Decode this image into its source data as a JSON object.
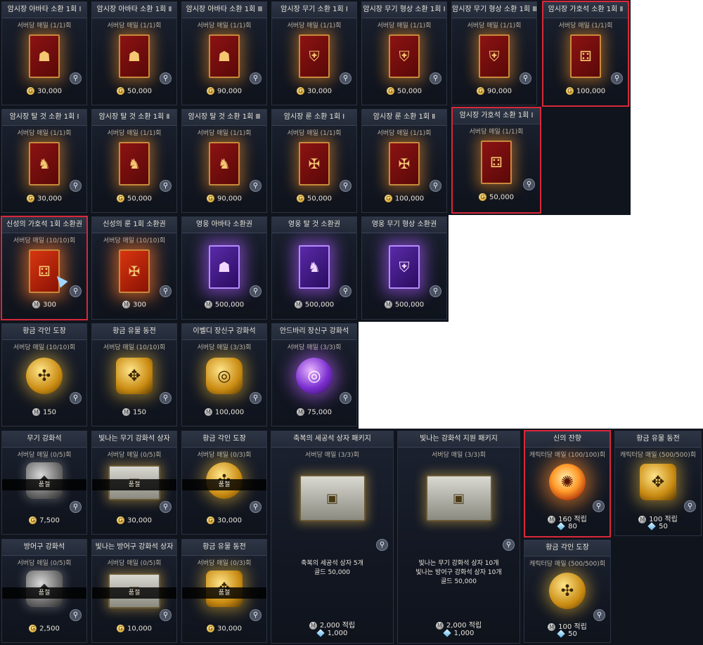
{
  "icons": {
    "zoom": "search-icon",
    "gold": "gold-coin-icon",
    "silver": "silver-coin-icon",
    "gem": "crystal-icon"
  },
  "colors": {
    "highlight": "#d8283a",
    "panel": "#10141d"
  },
  "cards": {
    "c1": {
      "title": "암시장 아바타 소환 1회 Ⅰ",
      "limit": "서버당 매일 (1/1)회",
      "price": "30,000"
    },
    "c2": {
      "title": "암시장 아바타 소환 1회 Ⅱ",
      "limit": "서버당 매일 (1/1)회",
      "price": "50,000"
    },
    "c3": {
      "title": "암시장 아바타 소환 1회 Ⅲ",
      "limit": "서버당 매일 (1/1)회",
      "price": "90,000"
    },
    "c4": {
      "title": "암시장 무기 소환 1회 Ⅰ",
      "limit": "서버당 매일 (1/1)회",
      "price": "30,000"
    },
    "c5": {
      "title": "암시장 무기 형상 소환 1회 Ⅰ",
      "limit": "서버당 매일 (1/1)회",
      "price": "50,000"
    },
    "c6": {
      "title": "암시장 무기 형상 소환 1회 Ⅲ",
      "limit": "서버당 매일 (1/1)회",
      "price": "90,000"
    },
    "c7": {
      "title": "암시장 가호석 소환 1회 Ⅱ",
      "limit": "서버당 매일 (1/1)회",
      "price": "100,000"
    },
    "c8": {
      "title": "암시장 탈 것 소환 1회 Ⅰ",
      "limit": "서버당 매일 (1/1)회",
      "price": "30,000"
    },
    "c9": {
      "title": "암시장 탈 것 소환 1회 Ⅱ",
      "limit": "서버당 매일 (1/1)회",
      "price": "50,000"
    },
    "c10": {
      "title": "암시장 탈 것 소환 1회 Ⅲ",
      "limit": "서버당 매일 (1/1)회",
      "price": "90,000"
    },
    "c11": {
      "title": "암시장 룬 소환 1회 Ⅰ",
      "limit": "서버당 매일 (1/1)회",
      "price": "50,000"
    },
    "c12": {
      "title": "암시장 룬 소환 1회 Ⅱ",
      "limit": "서버당 매일 (1/1)회",
      "price": "100,000"
    },
    "c13": {
      "title": "암시장 가호석 소환 1회 Ⅰ",
      "limit": "서버당 매일 (1/1)회",
      "price": "50,000"
    },
    "c14": {
      "title": "신성의 가호석 1회 소환권",
      "limit": "서버당 매일 (10/10)회",
      "price": "300"
    },
    "c15": {
      "title": "신성의 룬 1회 소환권",
      "limit": "서버당 매일 (10/10)회",
      "price": "300"
    },
    "c16": {
      "title": "영웅 아바타 소환권",
      "limit": "",
      "price": "500,000"
    },
    "c17": {
      "title": "영웅 탈 것 소환권",
      "limit": "",
      "price": "500,000"
    },
    "c18": {
      "title": "영웅 무기 형상 소환권",
      "limit": "",
      "price": "500,000"
    },
    "c19": {
      "title": "황금 각인 도장",
      "limit": "서버당 매일 (10/10)회",
      "price": "150"
    },
    "c20": {
      "title": "황금 유물 동전",
      "limit": "서버당 매일 (10/10)회",
      "price": "150"
    },
    "c21": {
      "title": "이벨디 장신구 강화석",
      "limit": "서버당 매일 (3/3)회",
      "price": "100,000"
    },
    "c22": {
      "title": "안드바리 장신구 강화석",
      "limit": "서버당 매일 (3/3)회",
      "price": "75,000"
    },
    "c23": {
      "title": "무기 강화석",
      "limit": "서버당 매일 (0/5)회",
      "price": "7,500",
      "soldout": "품절"
    },
    "c24": {
      "title": "빛나는 무기 강화석 상자",
      "limit": "서버당 매일 (0/5)회",
      "price": "30,000",
      "soldout": "품절"
    },
    "c25": {
      "title": "황금 각인 도장",
      "limit": "서버당 매일 (0/3)회",
      "price": "30,000",
      "soldout": "품절"
    },
    "c26": {
      "title": "축복의 세공석 상자 패키지",
      "limit": "서버당 매일 (3/3)회",
      "desc1": "축복의 세공석 상자 5개",
      "desc2": "골드 50,000",
      "desc3": "",
      "price": "2,000 적립",
      "price2": "1,000"
    },
    "c27": {
      "title": "빛나는 강화석 지원 패키지",
      "limit": "서버당 매일 (3/3)회",
      "desc1": "빛나는 무기 강화석 상자 10개",
      "desc2": "빛나는 방어구 강화석 상자 10개",
      "desc3": "골드 50,000",
      "price": "2,000 적립",
      "price2": "1,000"
    },
    "c28": {
      "title": "신의 잔향",
      "limit": "캐릭터당 매일 (100/100)회",
      "price": "160 적립",
      "price2": "80"
    },
    "c29": {
      "title": "황금 유물 동전",
      "limit": "캐릭터당 매일 (500/500)회",
      "price": "100 적립",
      "price2": "50"
    },
    "c30": {
      "title": "방어구 강화석",
      "limit": "서버당 매일 (0/5)회",
      "price": "2,500",
      "soldout": "품절"
    },
    "c31": {
      "title": "빛나는 방어구 강화석 상자",
      "limit": "서버당 매일 (0/5)회",
      "price": "10,000",
      "soldout": "품절"
    },
    "c32": {
      "title": "황금 유물 동전",
      "limit": "서버당 매일 (0/3)회",
      "price": "30,000",
      "soldout": "품절"
    },
    "c33": {
      "title": "황금 각인 도장",
      "limit": "캐릭터당 매일 (500/500)회",
      "price": "100 적립",
      "price2": "50"
    }
  }
}
